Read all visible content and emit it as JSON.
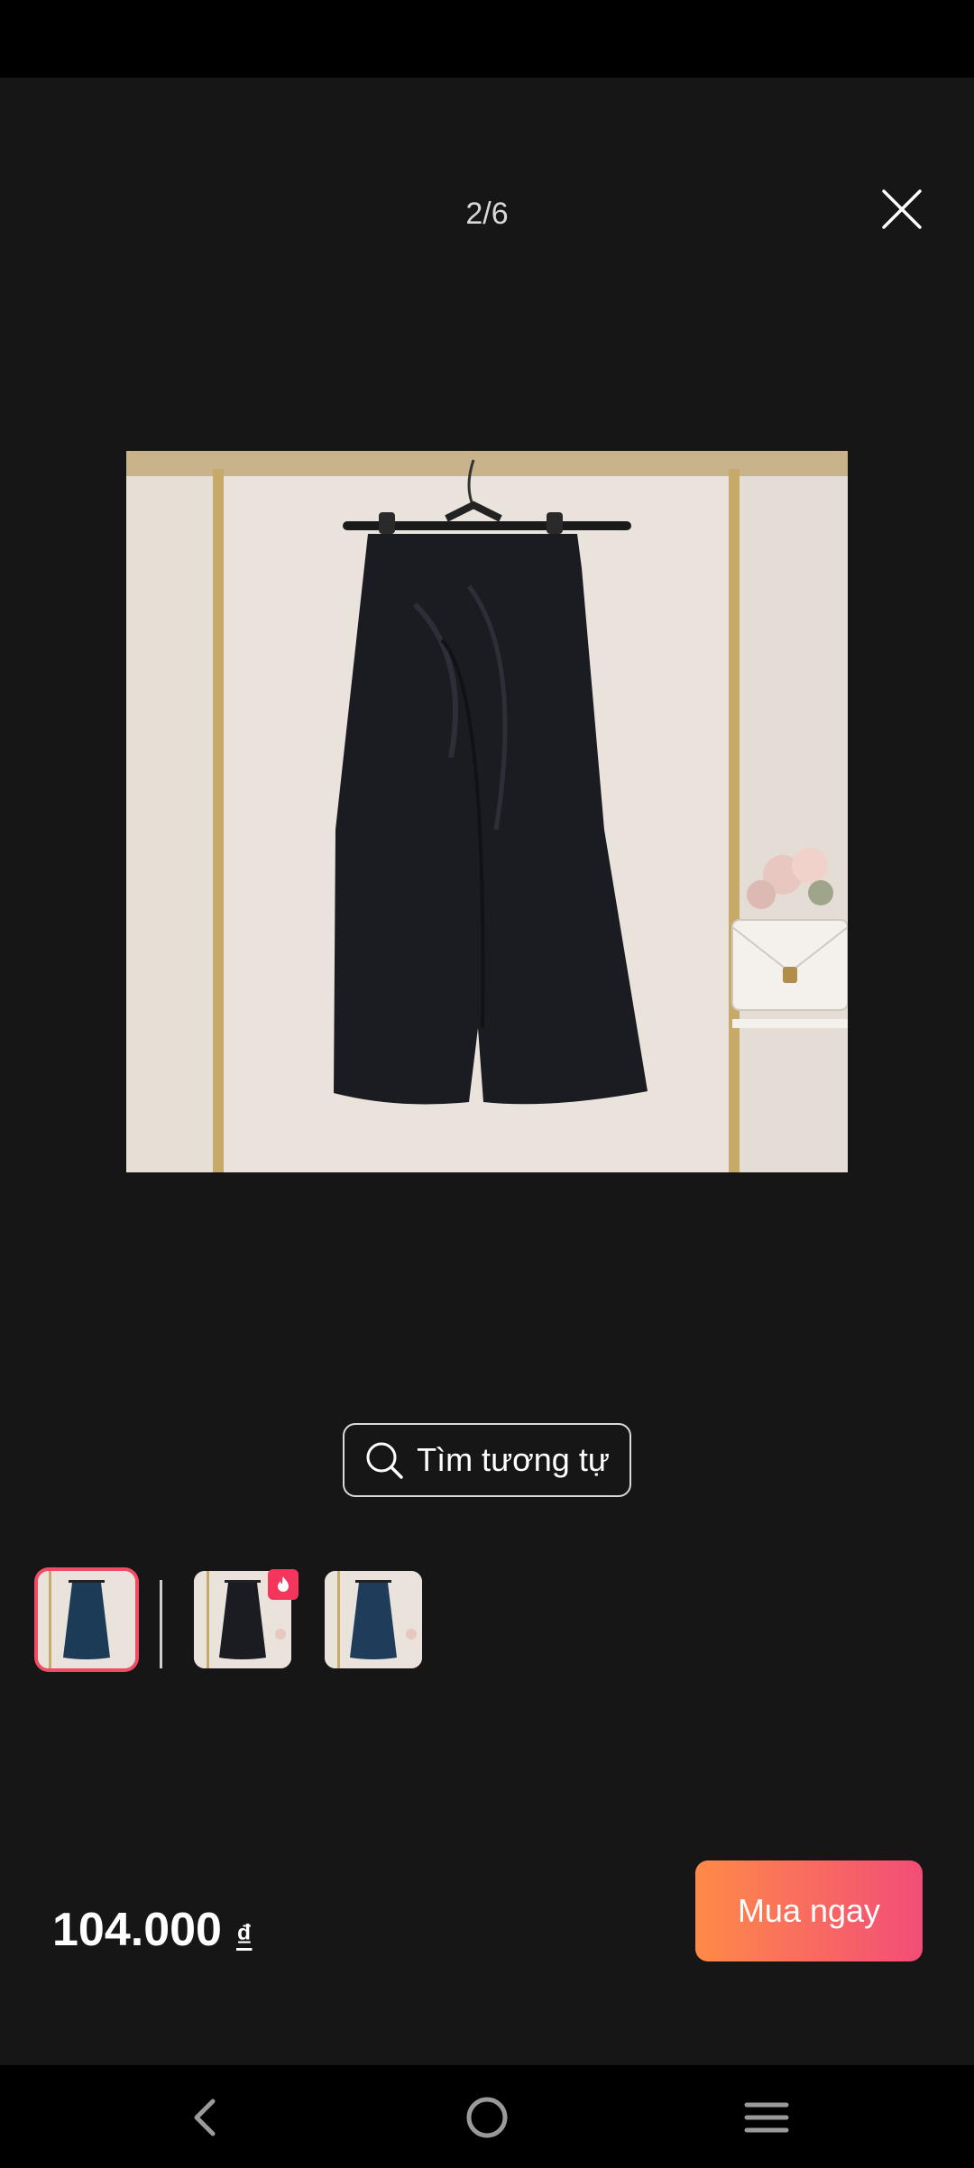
{
  "viewer": {
    "counter": "2/6"
  },
  "search_similar": {
    "label": "Tìm tương tự"
  },
  "thumbnails": [
    {
      "color": "navy",
      "selected": true
    },
    {
      "color": "black",
      "selected": false,
      "badge": "fire-icon"
    },
    {
      "color": "navy",
      "selected": false
    }
  ],
  "price": {
    "amount": "104.000",
    "currency": "₫"
  },
  "buy_button": {
    "label": "Mua ngay"
  },
  "colors": {
    "background": "#161616",
    "accent_gradient_start": "#ff8a48",
    "accent_gradient_end": "#f24d77",
    "selected_border": "#f04c64"
  }
}
